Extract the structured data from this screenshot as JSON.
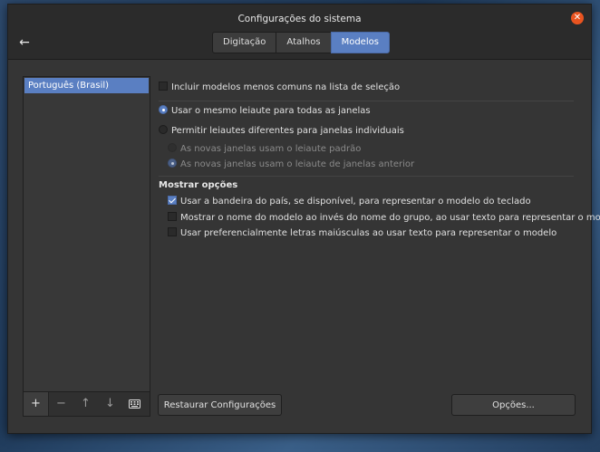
{
  "window": {
    "title": "Configurações do sistema"
  },
  "tabs": [
    {
      "label": "Digitação",
      "active": false
    },
    {
      "label": "Atalhos",
      "active": false
    },
    {
      "label": "Modelos",
      "active": true
    }
  ],
  "sidebar": {
    "items": [
      {
        "label": "Português (Brasil)",
        "selected": true
      }
    ],
    "toolbar": {
      "add": "+",
      "remove": "−",
      "up": "↑",
      "down": "↓",
      "keyboard_icon": "keyboard-icon"
    }
  },
  "options": {
    "include_less_common": {
      "label": "Incluir modelos menos comuns na lista de seleção",
      "checked": false
    },
    "same_layout": {
      "label": "Usar o mesmo leiaute para todas as janelas",
      "selected": true
    },
    "different_layouts": {
      "label": "Permitir leiautes diferentes para janelas individuais",
      "selected": false
    },
    "new_windows_default": {
      "label": "As novas janelas usam o leiaute padrão",
      "selected": false
    },
    "new_windows_previous": {
      "label": "As novas janelas usam o leiaute de janelas anterior",
      "selected": true
    }
  },
  "show_options": {
    "title": "Mostrar opções",
    "flag": {
      "label": "Usar a bandeira do país, se disponível, para representar o modelo do teclado",
      "checked": true
    },
    "model_name": {
      "label": "Mostrar o nome do modelo ao invés do nome do grupo, ao usar texto para representar o modelo",
      "checked": false
    },
    "uppercase": {
      "label": "Usar preferencialmente letras maiúsculas ao usar texto para representar o modelo",
      "checked": false
    }
  },
  "buttons": {
    "restore": "Restaurar Configurações",
    "options": "Opções..."
  },
  "colors": {
    "accent": "#5a7fc2",
    "close": "#e95420"
  }
}
